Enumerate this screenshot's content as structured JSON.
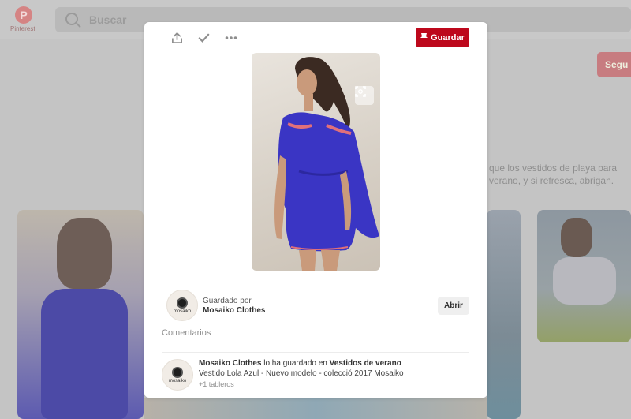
{
  "background": {
    "logo_label": "Pinterest",
    "search_placeholder": "Buscar",
    "follow_button": "Segu",
    "description_fragment": "que los vestidos de playa para verano, y si refresca, abrigan."
  },
  "toolbar": {
    "share_icon": "share-icon",
    "check_icon": "check-icon",
    "more_icon": "more-icon",
    "save_label": "Guardar"
  },
  "pin": {
    "image_description": "woman-in-blue-dress"
  },
  "saved_by": {
    "label": "Guardado por",
    "name": "Mosaiko Clothes",
    "avatar_text": "mosaiko",
    "open_label": "Abrir"
  },
  "comments": {
    "label": "Comentarios"
  },
  "activity": {
    "user": "Mosaiko Clothes",
    "action": " lo ha guardado en ",
    "board": "Vestidos de verano",
    "description": "Vestido Lola Azul - Nuevo modelo - colecció 2017 Mosaiko",
    "boards_count": "+1 tableros",
    "avatar_text": "mosaiko"
  },
  "colors": {
    "accent": "#bd081c",
    "dress": "#3a35c4"
  }
}
